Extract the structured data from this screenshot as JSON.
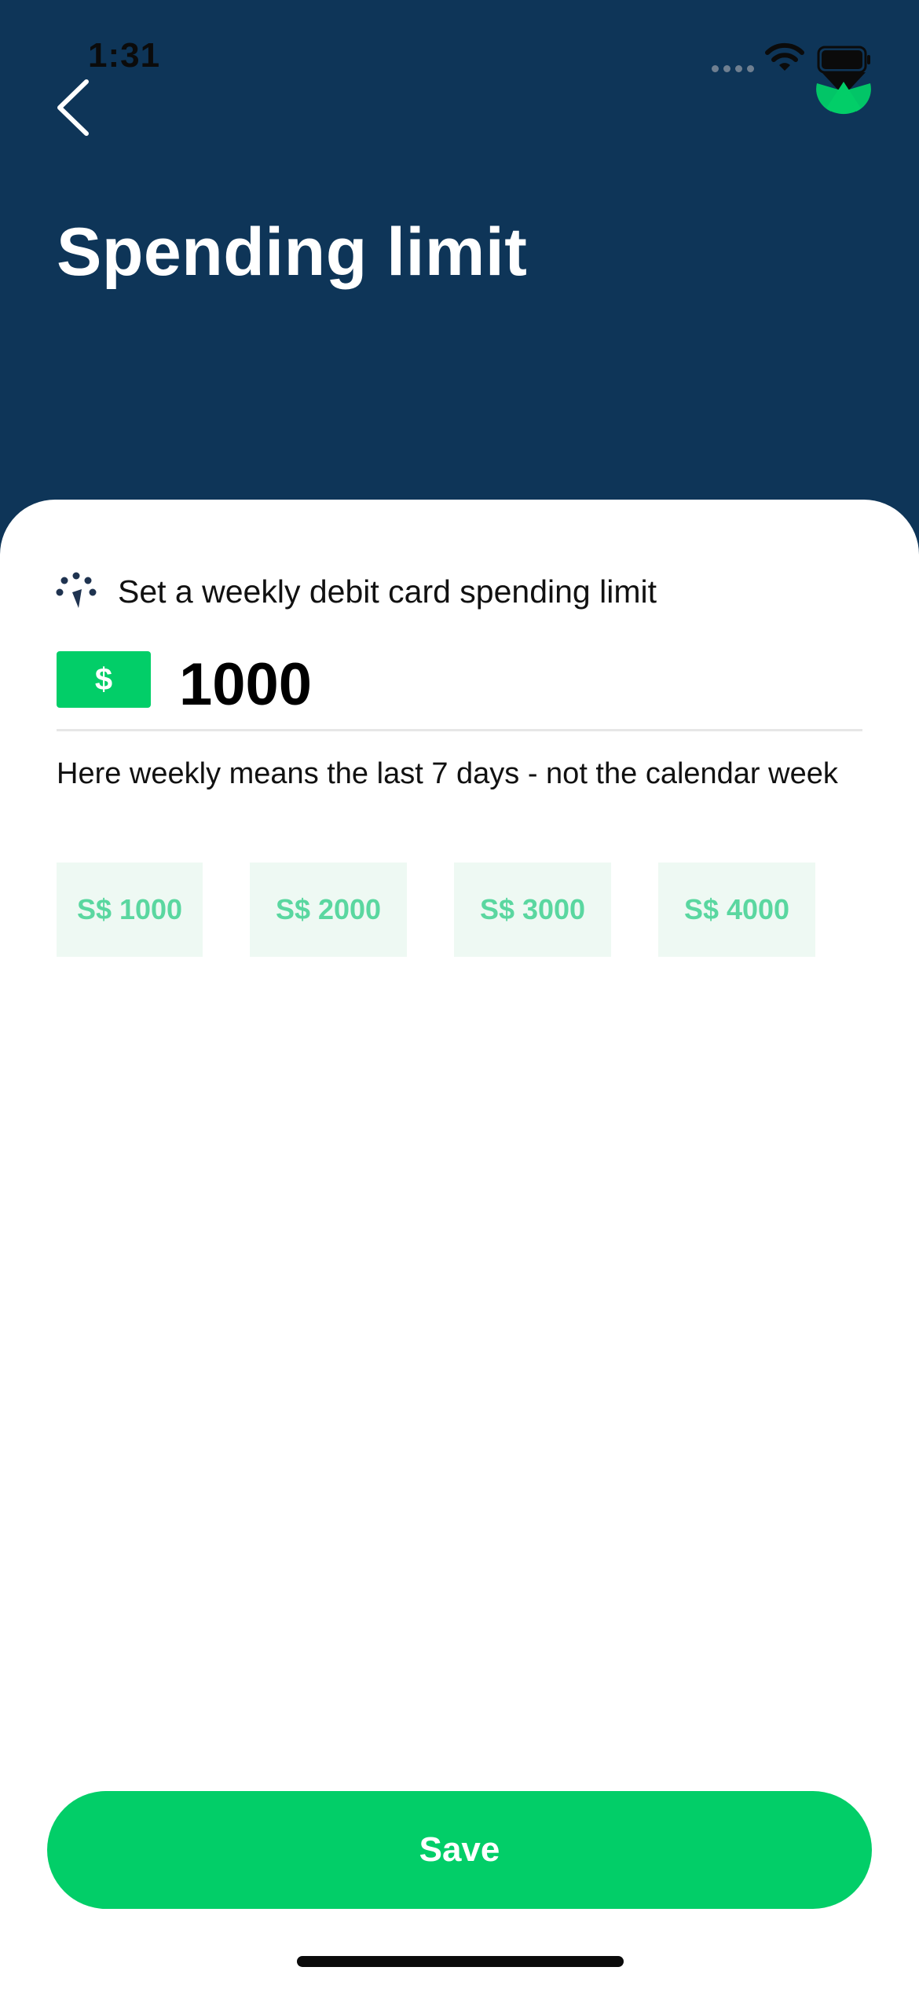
{
  "status_bar": {
    "time": "1:31"
  },
  "header": {
    "back_icon": "chevron-left-icon",
    "title": "Spending limit",
    "logo_icon": "app-logo-icon"
  },
  "limit": {
    "icon": "speedometer-icon",
    "label": "Set a weekly debit card spending limit",
    "currency_symbol": "$",
    "amount": "1000",
    "helper_text": "Here weekly means the last 7 days - not the calendar week"
  },
  "presets": [
    {
      "label": "S$ 1000"
    },
    {
      "label": "S$ 2000"
    },
    {
      "label": "S$ 3000"
    },
    {
      "label": "S$ 4000"
    }
  ],
  "actions": {
    "save_label": "Save"
  },
  "colors": {
    "header_bg": "#0e3558",
    "accent_green": "#02ce68",
    "chip_bg": "#eef9f3",
    "chip_text": "#5ad7a0"
  }
}
